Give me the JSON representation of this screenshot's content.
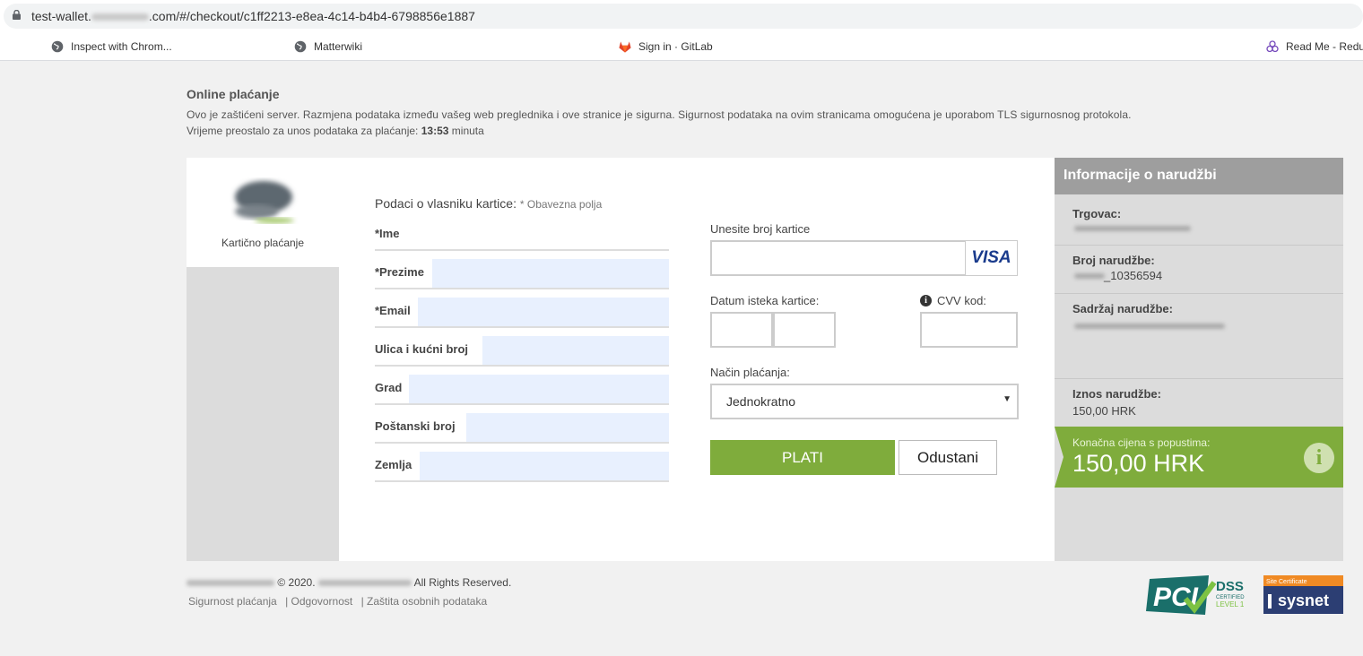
{
  "browser": {
    "url_prefix": "test-wallet.",
    "url_suffix": ".com/#/checkout/c1ff2213-e8ea-4c14-b4b4-6798856e1887",
    "bookmarks": [
      {
        "label": "Inspect with Chrom...",
        "icon": "globe-icon"
      },
      {
        "label": "Matterwiki",
        "icon": "globe-icon"
      },
      {
        "label": "Sign in · GitLab",
        "icon": "gitlab-icon"
      },
      {
        "label": "Read Me - Redu",
        "icon": "redux-icon"
      }
    ]
  },
  "header": {
    "title": "Online plaćanje",
    "secure_text": "Ovo je zaštićeni server. Razmjena podataka između vašeg web preglednika i ove stranice je sigurna. Sigurnost podataka na ovim stranicama omogućena je uporabom TLS sigurnosnog protokola.",
    "time_prefix": "Vrijeme preostalo za unos podataka za plaćanje:",
    "time_value": "13:53",
    "time_unit": "minuta"
  },
  "payment_method": {
    "label": "Kartično plaćanje"
  },
  "form": {
    "title": "Podaci o vlasniku kartice:",
    "required_note": "* Obavezna polja",
    "fields": [
      {
        "label": "*Ime",
        "value": ""
      },
      {
        "label": "*Prezime",
        "value": ""
      },
      {
        "label": "*Email",
        "value": ""
      },
      {
        "label": "Ulica i kućni broj",
        "value": ""
      },
      {
        "label": "Grad",
        "value": ""
      },
      {
        "label": "Poštanski broj",
        "value": ""
      },
      {
        "label": "Zemlja",
        "value": ""
      }
    ]
  },
  "card": {
    "number_label": "Unesite broj kartice",
    "brand": "VISA",
    "expiry_label": "Datum isteka kartice:",
    "cvv_label": "CVV kod:",
    "method_label": "Način plaćanja:",
    "method_value": "Jednokratno",
    "pay_button": "PLATI",
    "cancel_button": "Odustani"
  },
  "order_info": {
    "title": "Informacije o narudžbi",
    "merchant_label": "Trgovac:",
    "order_number_label": "Broj narudžbe:",
    "order_number_value": "_10356594",
    "contents_label": "Sadržaj narudžbe:",
    "amount_label": "Iznos narudžbe:",
    "amount_value": "150,00 HRK",
    "final_label": "Konačna cijena s popustima:",
    "final_value": "150,00 HRK"
  },
  "footer": {
    "copyright": "© 2020.",
    "rights": "All Rights Reserved.",
    "links": [
      "Sigurnost plaćanja",
      "| Odgovornost",
      "| Zaštita osobnih podataka"
    ]
  },
  "badges": {
    "pci_text": "DSS",
    "pci_sub1": "CERTIFIED",
    "pci_sub2": "LEVEL 1",
    "sysnet_top": "Site Certificate",
    "sysnet_name": "sysnet"
  },
  "colors": {
    "accent": "#7fac3c",
    "info_header": "#9e9e9e",
    "input_bg": "#e8f0fe"
  }
}
